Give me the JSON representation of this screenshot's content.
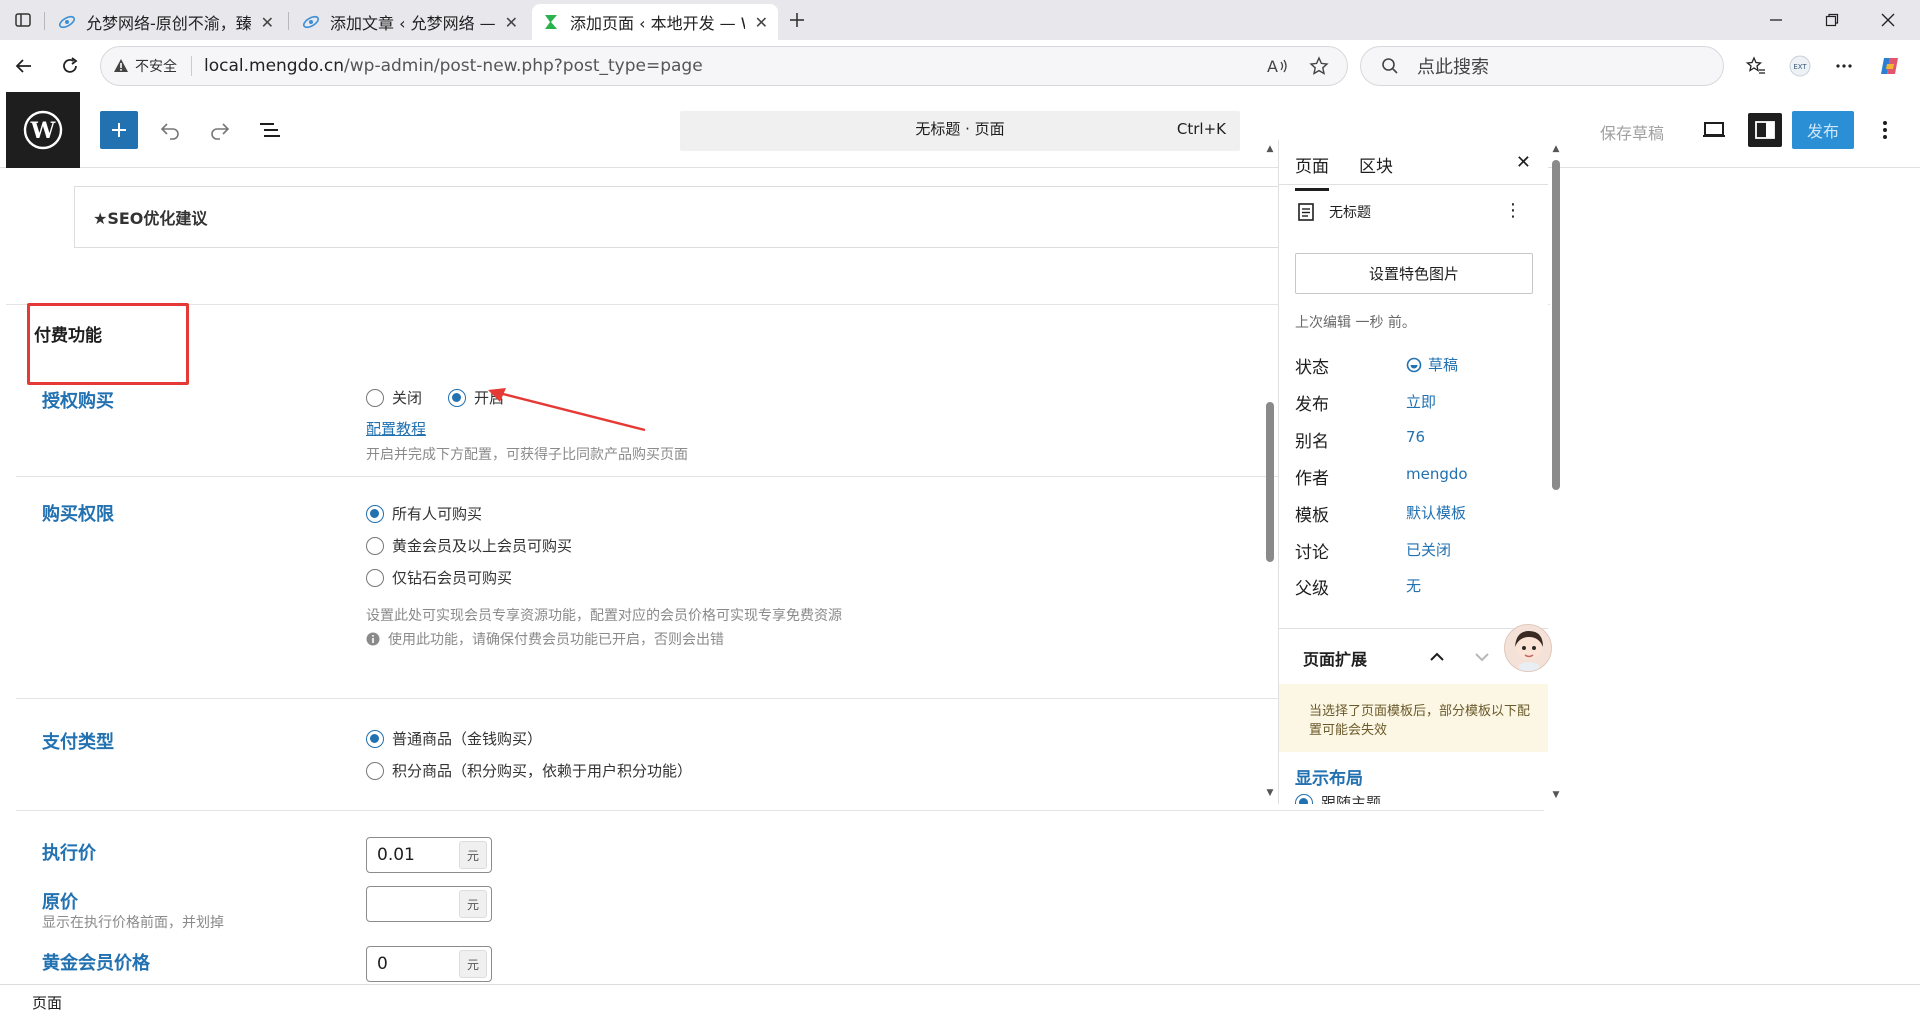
{
  "browser": {
    "tabs": [
      {
        "title": "允梦网络-原创不渝，臻求尽美!",
        "active": false
      },
      {
        "title": "添加文章 ‹ 允梦网络 — WordPress",
        "active": false
      },
      {
        "title": "添加页面 ‹ 本地开发 — WordPress",
        "active": true
      }
    ],
    "insecure_label": "不安全",
    "url_host": "local.mengdo.cn",
    "url_path": "/wp-admin/post-new.php?post_type=page",
    "search_placeholder": "点此搜索"
  },
  "editor": {
    "command_title": "无标题 · 页面",
    "command_shortcut": "Ctrl+K",
    "save_draft": "保存草稿",
    "publish": "发布"
  },
  "main": {
    "seo_title": "★SEO优化建议",
    "section_title": "付费功能",
    "fields": {
      "authorize": {
        "label": "授权购买",
        "options": [
          "关闭",
          "开启"
        ],
        "selected": "开启",
        "link": "配置教程",
        "help": "开启并完成下方配置，可获得子比同款产品购买页面"
      },
      "permission": {
        "label": "购买权限",
        "options": [
          "所有人可购买",
          "黄金会员及以上会员可购买",
          "仅钻石会员可购买"
        ],
        "selected": "所有人可购买",
        "help": "设置此处可实现会员专享资源功能，配置对应的会员价格可实现专享免费资源",
        "warning": "使用此功能，请确保付费会员功能已开启，否则会出错"
      },
      "pay_type": {
        "label": "支付类型",
        "options": [
          "普通商品（金钱购买）",
          "积分商品（积分购买，依赖于用户积分功能）"
        ],
        "selected": "普通商品（金钱购买）"
      },
      "price": {
        "label": "执行价",
        "value": "0.01",
        "unit": "元"
      },
      "original_price": {
        "label": "原价",
        "note": "显示在执行价格前面，并划掉",
        "value": "",
        "unit": "元"
      },
      "gold_price": {
        "label": "黄金会员价格",
        "value": "0",
        "unit": "元"
      }
    }
  },
  "sidebar": {
    "tabs": [
      "页面",
      "区块"
    ],
    "active_tab": "页面",
    "doc_title": "无标题",
    "featured_image": "设置特色图片",
    "last_edit": "上次编辑 一秒 前。",
    "meta": [
      {
        "key": "状态",
        "value": "草稿"
      },
      {
        "key": "发布",
        "value": "立即"
      },
      {
        "key": "别名",
        "value": "76"
      },
      {
        "key": "作者",
        "value": "mengdo"
      },
      {
        "key": "模板",
        "value": "默认模板"
      },
      {
        "key": "讨论",
        "value": "已关闭"
      },
      {
        "key": "父级",
        "value": "无"
      }
    ],
    "extension_title": "页面扩展",
    "notice": "当选择了页面模板后，部分模板以下配置可能会失效",
    "layout_title": "显示布局",
    "layout_option": "跟随主题"
  },
  "statusbar": {
    "label": "页面"
  },
  "colors": {
    "accent": "#2271b1",
    "annotation": "#e53935"
  }
}
